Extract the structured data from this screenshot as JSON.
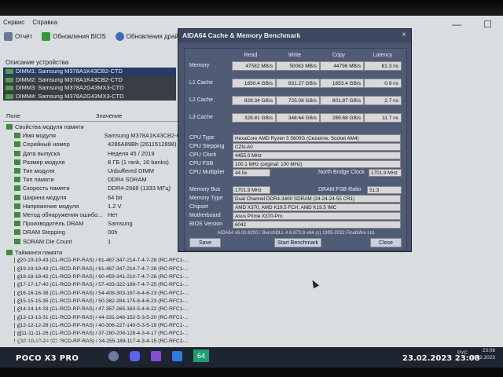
{
  "menu": [
    "Сервис",
    "Справка"
  ],
  "toolbar": {
    "report_label": "Отчёт",
    "bios_label": "Обновления BIOS",
    "drivers_label": "Обновления драйверов"
  },
  "devices_label": "Описание устройства",
  "dimm_items": [
    "DIMM1: Samsung M378A1K43CB2-CTD",
    "DIMM2: Samsung M378A1K43CB2-CTD",
    "DIMM3: Samsung M378A2G43MX3-CTD",
    "DIMM4: Samsung M378A2G43MX3-CTD"
  ],
  "columns": {
    "field": "Поле",
    "value": "Значение"
  },
  "properties": [
    {
      "name": "Свойства модуля памяти",
      "value": "",
      "group": true
    },
    {
      "name": "Имя модуля",
      "value": "Samsung M378A1K43CB2-CTD"
    },
    {
      "name": "Серийный номер",
      "value": "4286A89Bh (2611512898)"
    },
    {
      "name": "Дата выпуска",
      "value": "Неделя 45 / 2019"
    },
    {
      "name": "Размер модуля",
      "value": "8 ГБ (1 rank, 16 banks)"
    },
    {
      "name": "Тип модуля",
      "value": "Unbuffered DIMM"
    },
    {
      "name": "Тип памяти",
      "value": "DDR4 SDRAM"
    },
    {
      "name": "Скорость памяти",
      "value": "DDR4-2666 (1333 МГц)"
    },
    {
      "name": "Ширина модуля",
      "value": "64 bit"
    },
    {
      "name": "Напряжение модуля",
      "value": "1.2 V"
    },
    {
      "name": "Метод обнаружения ошибо...",
      "value": "Нет"
    },
    {
      "name": "Производитель DRAM",
      "value": "Samsung"
    },
    {
      "name": "DRAM Stepping",
      "value": "00h"
    },
    {
      "name": "SDRAM Die Count",
      "value": "1"
    }
  ],
  "timings_header": "Тайминги памяти",
  "timings": [
    {
      "name": "@ 1333 МГц",
      "value": "20-19-19-43  (CL-RCD-RP-RAS) / 61-467-347-214-7-4-7-28  (RC-RFC1-..."
    },
    {
      "name": "@ 1333 МГц",
      "value": "19-19-19-43  (CL-RCD-RP-RAS) / 61-467-347-214-7-4-7-28  (RC-RFC1-..."
    },
    {
      "name": "@ 1309 МГц",
      "value": "18-18-18-42  (CL-RCD-RP-RAS) / 60-459-341-210-7-4-7-26  (RC-RFC1-..."
    },
    {
      "name": "@ 1236 МГц",
      "value": "17-17-17-40  (CL-RCD-RP-RAS) / 57-433-322-198-7-4-7-25  (RC-RFC1-..."
    },
    {
      "name": "@ 1163 МГц",
      "value": "16-16-16-38  (CL-RCD-RP-RAS) / 54-408-303-187-6-4-6-23  (RC-RFC1-..."
    },
    {
      "name": "@ 1090 МГц",
      "value": "15-15-15-35  (CL-RCD-RP-RAS) / 50-382-284-175-6-4-6-23  (RC-RFC1-..."
    },
    {
      "name": "@ 1018 МГц",
      "value": "14-14-14-33  (CL-RCD-RP-RAS) / 47-357-265-163-5-4-6-22  (RC-RFC1-..."
    },
    {
      "name": "@ 945 МГц",
      "value": "13-13-13-31  (CL-RCD-RP-RAS) / 44-331-246-152-5-3-5-20  (RC-RFC1-..."
    },
    {
      "name": "@ 872 МГц",
      "value": "12-12-12-28  (CL-RCD-RP-RAS) / 40-306-227-140-5-3-5-19  (RC-RFC1-..."
    },
    {
      "name": "@ 800 МГц",
      "value": "11-11-11-26  (CL-RCD-RP-RAS) / 37-280-208-128-4-3-4-17  (RC-RFC1-..."
    },
    {
      "name": "@ 727 МГц",
      "value": "10-10-10-24  (CL-RCD-RP-RAS) / 34-255-189-117-4-3-4-15  (RC-RFC1-..."
    }
  ],
  "dialog": {
    "title": "AIDA64 Cache & Memory Benchmark",
    "close_glyph": "×",
    "headers": [
      "Read",
      "Write",
      "Copy",
      "Latency"
    ],
    "rows": [
      {
        "label": "Memory",
        "values": [
          "47582 MB/s",
          "50063 MB/s",
          "44796 MB/s",
          "81.3 ns"
        ]
      },
      {
        "label": "L1 Cache",
        "values": [
          "1650.4 GB/s",
          "831.27 GB/s",
          "1653.4 GB/s",
          "0.9 ns"
        ]
      },
      {
        "label": "L2 Cache",
        "values": [
          "828.34 GB/s",
          "725.08 GB/s",
          "801.87 GB/s",
          "2.7 ns"
        ]
      },
      {
        "label": "L3 Cache",
        "values": [
          "328.81 GB/s",
          "348.64 GB/s",
          "289.68 GB/s",
          "11.7 ns"
        ]
      }
    ],
    "cpu": {
      "type_label": "CPU Type",
      "type": "HexaCore AMD Ryzen 5 5600G  (Cezanne, Socket AM4)",
      "stepping_label": "CPU Stepping",
      "stepping": "CZN-A0",
      "clock_label": "CPU Clock",
      "clock": "4455.0 MHz",
      "fsb_label": "CPU FSB",
      "fsb": "100.1 MHz  (original: 100 MHz)",
      "mult_label": "CPU Multiplier",
      "mult": "44.5x",
      "nb_label": "North Bridge Clock",
      "nb": "1701.9 MHz"
    },
    "mem": {
      "bus_label": "Memory Bus",
      "bus": "1701.9 MHz",
      "ratio_label": "DRAM:FSB Ratio",
      "ratio": "51:3",
      "type_label": "Memory Type",
      "type": "Dual Channel DDR4-3400 SDRAM  (24-24-24-55 CR1)",
      "chipset_label": "Chipset",
      "chipset": "AMD X370, AMD K19.5 FCH, AMD K19.5 IMC",
      "mb_label": "Motherboard",
      "mb": "Asus Prime X370-Pro",
      "bios_label": "BIOS Version",
      "bios": "6042"
    },
    "footer": "AIDA64 v6.00.6200 / BenchDLL 4.6.873.8-x64  (c) 1995-2022 FinalWire Ltd.",
    "save": "Save",
    "start": "Start Benchmark",
    "close": "Close"
  },
  "taskbar": {
    "aida_label": "64",
    "lang": "РУС",
    "time": "23:08",
    "date": "23.02.2023"
  },
  "watermark": {
    "left": "POCO X3 PRO",
    "right": "23.02.2023  23:08"
  }
}
